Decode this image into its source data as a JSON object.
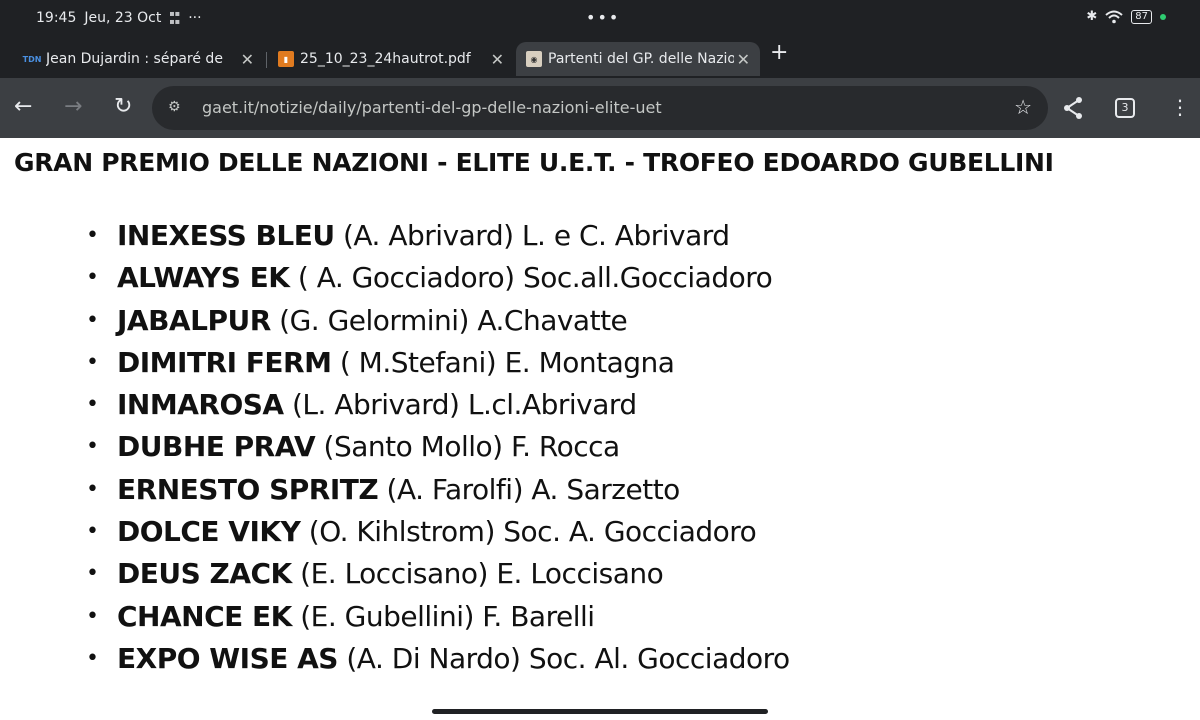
{
  "status_bar": {
    "time": "19:45",
    "date": "Jeu, 23 Oct",
    "battery": "87",
    "icons": [
      "bluetooth-icon",
      "wifi-icon",
      "battery-icon"
    ]
  },
  "tabs": [
    {
      "favicon": "TDN",
      "title": "Jean Dujardin : séparé de Na",
      "active": false
    },
    {
      "favicon": "pdf",
      "title": "25_10_23_24hautrot.pdf",
      "active": false
    },
    {
      "favicon": "gaet",
      "title": "Partenti del GP. delle Nazion",
      "active": true
    }
  ],
  "toolbar": {
    "url": "gaet.it/notizie/daily/partenti-del-gp-delle-nazioni-elite-uet",
    "tab_count": "3"
  },
  "page": {
    "title": "GRAN PREMIO DELLE NAZIONI - ELITE U.E.T. - TROFEO EDOARDO GUBELLINI",
    "entries": [
      {
        "horse": "INEXESS BLEU",
        "details": " (A. Abrivard) L. e C. Abrivard"
      },
      {
        "horse": "ALWAYS EK",
        "details": " ( A. Gocciadoro) Soc.all.Gocciadoro"
      },
      {
        "horse": "JABALPUR",
        "details": " (G. Gelormini) A.Chavatte"
      },
      {
        "horse": "DIMITRI FERM",
        "details": " ( M.Stefani) E. Montagna"
      },
      {
        "horse": "INMAROSA",
        "details": " (L. Abrivard) L.cl.Abrivard"
      },
      {
        "horse": "DUBHE PRAV",
        "details": " (Santo Mollo) F. Rocca"
      },
      {
        "horse": "ERNESTO SPRITZ",
        "details": " (A. Farolfi) A. Sarzetto"
      },
      {
        "horse": "DOLCE VIKY",
        "details": " (O. Kihlstrom) Soc. A. Gocciadoro"
      },
      {
        "horse": "DEUS ZACK",
        "details": " (E. Loccisano) E. Loccisano"
      },
      {
        "horse": "CHANCE EK",
        "details": " (E. Gubellini) F. Barelli"
      },
      {
        "horse": "EXPO WISE AS",
        "details": " (A. Di Nardo) Soc. Al. Gocciadoro"
      }
    ]
  },
  "colors": {
    "chrome_dark": "#1f2124",
    "toolbar": "#3c3f43",
    "omnibox": "#282a2d",
    "text": "#111111"
  }
}
